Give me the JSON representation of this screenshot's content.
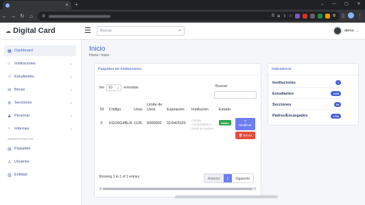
{
  "brand": {
    "name": "Digital Card"
  },
  "search": {
    "placeholder": "Buscar"
  },
  "user": {
    "name": "demo"
  },
  "sidebar": {
    "items": [
      {
        "label": "Dashboard",
        "icon": "grid-icon"
      },
      {
        "label": "Instituciones",
        "icon": "bank-icon"
      },
      {
        "label": "Estudiantes",
        "icon": "students-icon"
      },
      {
        "label": "Becas",
        "icon": "scholarship-icon"
      },
      {
        "label": "Secciones",
        "icon": "sections-icon"
      },
      {
        "label": "Personal",
        "icon": "person-icon"
      },
      {
        "label": "Informes",
        "icon": "reports-icon"
      }
    ],
    "section_heading": "ADMINISTRACIÓN",
    "admin_items": [
      {
        "label": "Paquetes",
        "icon": "package-icon"
      },
      {
        "label": "Usuarios",
        "icon": "users-icon"
      },
      {
        "label": "Entidad",
        "icon": "building-icon"
      }
    ]
  },
  "page": {
    "title": "Inicio",
    "breadcrumb": {
      "home": "Home",
      "sep": "/",
      "current": "Inicio"
    }
  },
  "packages": {
    "title": "Paquetes de Instituciones",
    "length_prefix": "Ver",
    "length_value": "10",
    "length_suffix": "entradas",
    "filter_label": "Buscar:",
    "columns": [
      "ID",
      "Código",
      "Usos",
      "Limite de Usos",
      "Expiración",
      "Institución",
      "Estado"
    ],
    "rows": [
      {
        "id": "3",
        "code": "KGG5G4BLN",
        "uses": "1135",
        "limit": "5000000",
        "expiration": "01/04/2025",
        "institution": "Colegio Ambientalista el Roble de Alajuela",
        "status": "Valido",
        "edit_label": "Modificar",
        "delete_label": "Borrar"
      }
    ],
    "info": "Showing 1 to 1 of 1 entries",
    "pager": {
      "prev": "Anterior",
      "current": "1",
      "next": "Siguiente"
    }
  },
  "indicators": {
    "title": "Indicadores",
    "items": [
      {
        "label": "Instituciones",
        "value": "1"
      },
      {
        "label": "Estudiantes",
        "value": "1135"
      },
      {
        "label": "Secciones",
        "value": "39"
      },
      {
        "label": "Padres/Encargados",
        "value": "1796"
      }
    ]
  },
  "colors": {
    "accent": "#3d5bd9",
    "success": "#2fa84f",
    "danger": "#e74c3c",
    "button": "#6c7ef2"
  }
}
